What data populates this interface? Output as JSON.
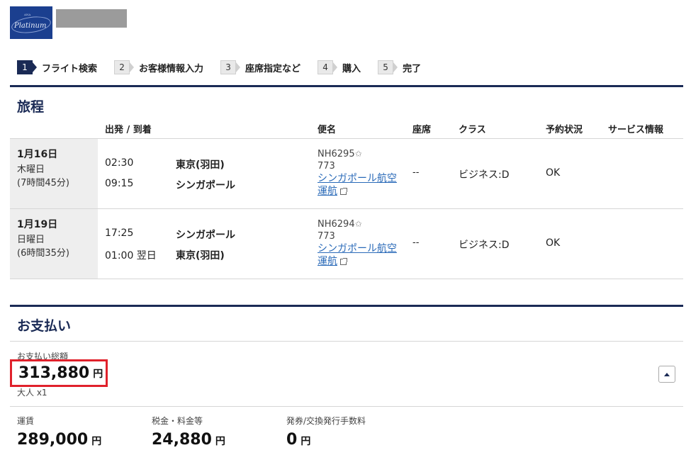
{
  "header": {
    "logo_text": "ANA",
    "logo_script": "Platinum"
  },
  "steps": [
    {
      "num": "1",
      "label": "フライト検索"
    },
    {
      "num": "2",
      "label": "お客様情報入力"
    },
    {
      "num": "3",
      "label": "座席指定など"
    },
    {
      "num": "4",
      "label": "購入"
    },
    {
      "num": "5",
      "label": "完了"
    }
  ],
  "itinerary": {
    "title": "旅程",
    "columns": {
      "dep_arr": "出発 / 到着",
      "flight": "便名",
      "seat": "座席",
      "class": "クラス",
      "status": "予約状況",
      "service": "サービス情報"
    },
    "segments": [
      {
        "date": "1月16日",
        "weekday": "木曜日",
        "duration": "(7時間45分)",
        "dep_time": "02:30",
        "dep_place": "東京(羽田)",
        "arr_time": "09:15",
        "arr_place": "シンガポール",
        "flight_no": "NH6295",
        "aircraft": "773",
        "operator_line1": "シンガポール航空",
        "operator_line2": "運航",
        "seat": "--",
        "class": "ビジネス:D",
        "status": "OK"
      },
      {
        "date": "1月19日",
        "weekday": "日曜日",
        "duration": "(6時間35分)",
        "dep_time": "17:25",
        "dep_place": "シンガポール",
        "arr_time": "01:00 翌日",
        "arr_place": "東京(羽田)",
        "flight_no": "NH6294",
        "aircraft": "773",
        "operator_line1": "シンガポール航空",
        "operator_line2": "運航",
        "seat": "--",
        "class": "ビジネス:D",
        "status": "OK"
      }
    ]
  },
  "payment": {
    "title": "お支払い",
    "total_label": "お支払い総額",
    "total_amount": "313,880",
    "currency": "円",
    "pax": "大人 x1",
    "breakdown": [
      {
        "label": "運賃",
        "amount": "289,000"
      },
      {
        "label": "税金・料金等",
        "amount": "24,880"
      },
      {
        "label": "発券/交換発行手数料",
        "amount": "0"
      }
    ]
  },
  "colors": {
    "navy": "#1a2a55",
    "link": "#2a6ab8",
    "highlight": "#e0212b"
  }
}
